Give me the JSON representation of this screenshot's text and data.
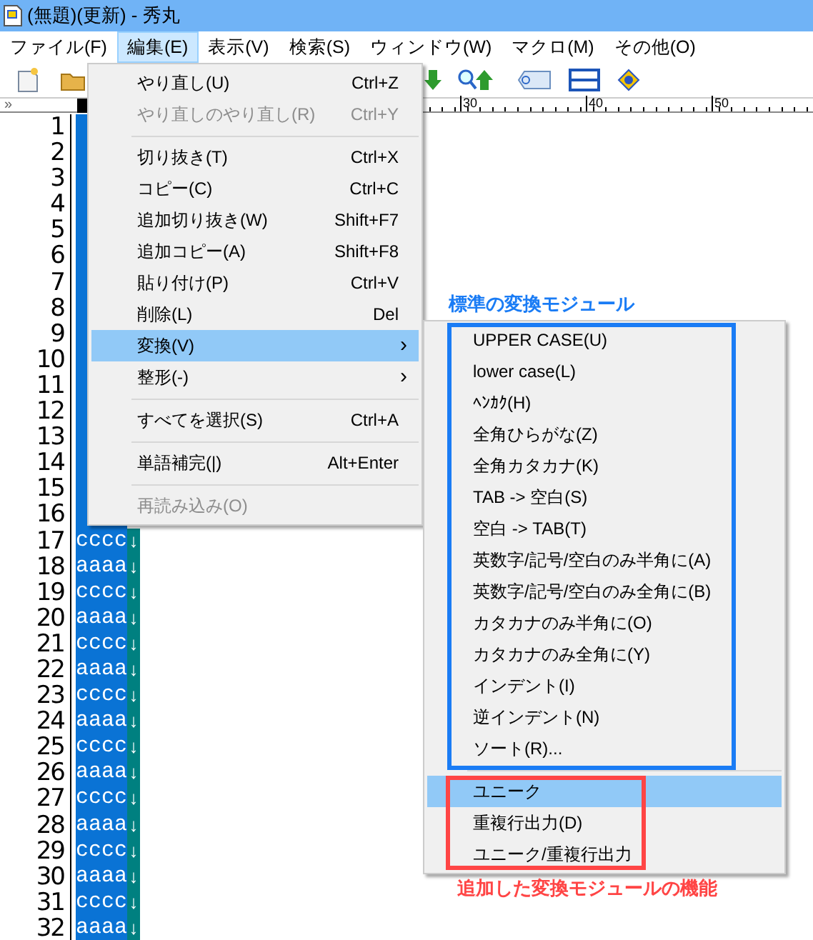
{
  "window": {
    "title": "(無題)(更新) - 秀丸"
  },
  "menubar": [
    {
      "label": "ファイル(F)",
      "selected": false
    },
    {
      "label": "編集(E)",
      "selected": true
    },
    {
      "label": "表示(V)",
      "selected": false
    },
    {
      "label": "検索(S)",
      "selected": false
    },
    {
      "label": "ウィンドウ(W)",
      "selected": false
    },
    {
      "label": "マクロ(M)",
      "selected": false
    },
    {
      "label": "その他(O)",
      "selected": false
    }
  ],
  "ruler": {
    "marker": "»",
    "labels": [
      "30",
      "40",
      "50"
    ]
  },
  "lines": [
    {
      "number": "1",
      "selected": true
    },
    {
      "number": "2",
      "selected": true
    },
    {
      "number": "3",
      "selected": true
    },
    {
      "number": "4",
      "selected": true
    },
    {
      "number": "5",
      "selected": true
    },
    {
      "number": "6",
      "selected": true
    },
    {
      "number": "7",
      "selected": true
    },
    {
      "number": "8",
      "selected": true
    },
    {
      "number": "9",
      "selected": true
    },
    {
      "number": "10",
      "selected": true
    },
    {
      "number": "11",
      "selected": true
    },
    {
      "number": "12",
      "selected": true
    },
    {
      "number": "13",
      "selected": true
    },
    {
      "number": "14",
      "selected": true
    },
    {
      "number": "15",
      "selected": true
    },
    {
      "number": "16",
      "selected": true
    },
    {
      "number": "17",
      "text": "cccc",
      "eol": "↓",
      "selected": true
    },
    {
      "number": "18",
      "text": "aaaa",
      "eol": "↓",
      "selected": true
    },
    {
      "number": "19",
      "text": "cccc",
      "eol": "↓",
      "selected": true
    },
    {
      "number": "20",
      "text": "aaaa",
      "eol": "↓",
      "selected": true
    },
    {
      "number": "21",
      "text": "cccc",
      "eol": "↓",
      "selected": true
    },
    {
      "number": "22",
      "text": "aaaa",
      "eol": "↓",
      "selected": true
    },
    {
      "number": "23",
      "text": "cccc",
      "eol": "↓",
      "selected": true
    },
    {
      "number": "24",
      "text": "aaaa",
      "eol": "↓",
      "selected": true
    },
    {
      "number": "25",
      "text": "cccc",
      "eol": "↓",
      "selected": true
    },
    {
      "number": "26",
      "text": "aaaa",
      "eol": "↓",
      "selected": true
    },
    {
      "number": "27",
      "text": "cccc",
      "eol": "↓",
      "selected": true
    },
    {
      "number": "28",
      "text": "aaaa",
      "eol": "↓",
      "selected": true
    },
    {
      "number": "29",
      "text": "cccc",
      "eol": "↓",
      "selected": true
    },
    {
      "number": "30",
      "text": "aaaa",
      "eol": "↓",
      "selected": true
    },
    {
      "number": "31",
      "text": "cccc",
      "eol": "↓",
      "selected": true
    },
    {
      "number": "32",
      "text": "aaaa",
      "eol": "↓",
      "selected": true
    }
  ],
  "edit_menu": [
    {
      "kind": "item",
      "label": "やり直し(U)",
      "shortcut": "Ctrl+Z",
      "disabled": false,
      "selected": false
    },
    {
      "kind": "item",
      "label": "やり直しのやり直し(R)",
      "shortcut": "Ctrl+Y",
      "disabled": true,
      "selected": false
    },
    {
      "kind": "separator"
    },
    {
      "kind": "item",
      "label": "切り抜き(T)",
      "shortcut": "Ctrl+X",
      "disabled": false,
      "selected": false
    },
    {
      "kind": "item",
      "label": "コピー(C)",
      "shortcut": "Ctrl+C",
      "disabled": false,
      "selected": false
    },
    {
      "kind": "item",
      "label": "追加切り抜き(W)",
      "shortcut": "Shift+F7",
      "disabled": false,
      "selected": false
    },
    {
      "kind": "item",
      "label": "追加コピー(A)",
      "shortcut": "Shift+F8",
      "disabled": false,
      "selected": false
    },
    {
      "kind": "item",
      "label": "貼り付け(P)",
      "shortcut": "Ctrl+V",
      "disabled": false,
      "selected": false
    },
    {
      "kind": "item",
      "label": "削除(L)",
      "shortcut": "Del",
      "disabled": false,
      "selected": false
    },
    {
      "kind": "item",
      "label": "変換(V)",
      "submenu": "›",
      "disabled": false,
      "selected": true
    },
    {
      "kind": "item",
      "label": "整形(-)",
      "submenu": "›",
      "disabled": false,
      "selected": false
    },
    {
      "kind": "separator"
    },
    {
      "kind": "item",
      "label": "すべてを選択(S)",
      "shortcut": "Ctrl+A",
      "disabled": false,
      "selected": false
    },
    {
      "kind": "separator"
    },
    {
      "kind": "item",
      "label": "単語補完(|)",
      "shortcut": "Alt+Enter",
      "disabled": false,
      "selected": false
    },
    {
      "kind": "separator"
    },
    {
      "kind": "item",
      "label": "再読み込み(O)",
      "disabled": true,
      "selected": false
    }
  ],
  "convert_submenu": [
    {
      "kind": "item",
      "label": "UPPER CASE(U)",
      "selected": false
    },
    {
      "kind": "item",
      "label": "lower case(L)",
      "selected": false
    },
    {
      "kind": "item",
      "label": "ﾍﾝｶｸ(H)",
      "selected": false
    },
    {
      "kind": "item",
      "label": "全角ひらがな(Z)",
      "selected": false
    },
    {
      "kind": "item",
      "label": "全角カタカナ(K)",
      "selected": false
    },
    {
      "kind": "item",
      "label": "TAB -> 空白(S)",
      "selected": false
    },
    {
      "kind": "item",
      "label": "空白 -> TAB(T)",
      "selected": false
    },
    {
      "kind": "item",
      "label": "英数字/記号/空白のみ半角に(A)",
      "selected": false
    },
    {
      "kind": "item",
      "label": "英数字/記号/空白のみ全角に(B)",
      "selected": false
    },
    {
      "kind": "item",
      "label": "カタカナのみ半角に(O)",
      "selected": false
    },
    {
      "kind": "item",
      "label": "カタカナのみ全角に(Y)",
      "selected": false
    },
    {
      "kind": "item",
      "label": "インデント(I)",
      "selected": false
    },
    {
      "kind": "item",
      "label": "逆インデント(N)",
      "selected": false
    },
    {
      "kind": "item",
      "label": "ソート(R)...",
      "selected": false
    },
    {
      "kind": "separator"
    },
    {
      "kind": "item",
      "label": "ユニーク",
      "selected": true
    },
    {
      "kind": "item",
      "label": "重複行出力(D)",
      "selected": false
    },
    {
      "kind": "item",
      "label": "ユニーク/重複行出力",
      "selected": false
    }
  ],
  "annotations": [
    {
      "label": "標準の変換モジュール",
      "color": "#1a7cf5"
    },
    {
      "label": "追加した変換モジュールの機能",
      "color": "#ff4545"
    }
  ]
}
